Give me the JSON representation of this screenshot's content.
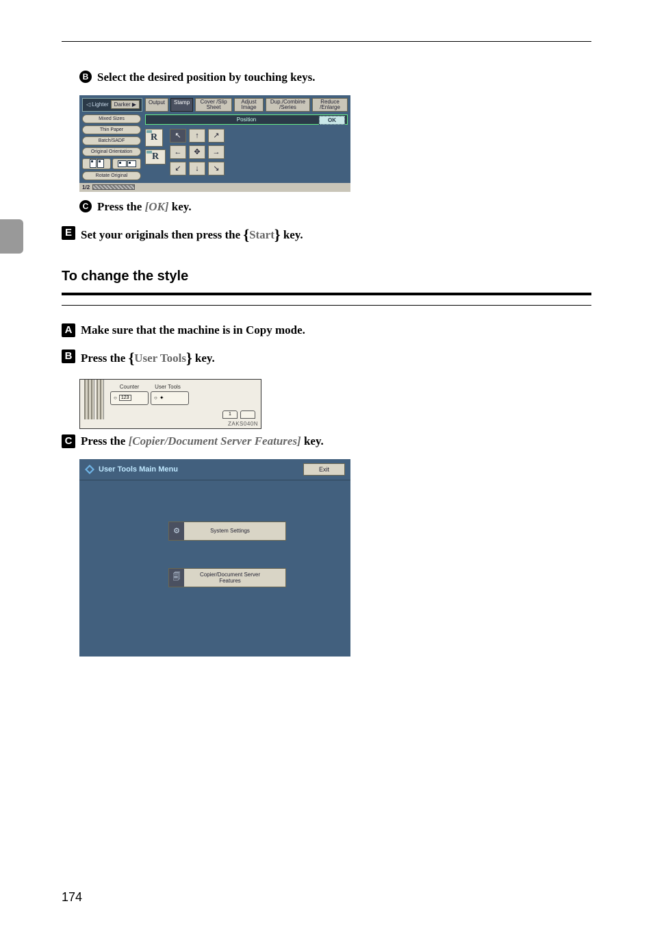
{
  "page_number": "174",
  "steps_upper": {
    "sub_b": "Select the desired position by touching keys.",
    "sub_c_prefix": "Press the ",
    "sub_c_key": "[OK]",
    "sub_c_suffix": " key.",
    "step5_prefix": "Set your originals then press the ",
    "step5_key": "Start",
    "step5_suffix": " key."
  },
  "section_title": "To change the style",
  "steps_lower": {
    "step1": "Make sure that the machine is in Copy mode.",
    "step2_prefix": "Press the ",
    "step2_key": "User Tools",
    "step2_suffix": " key.",
    "step3_prefix": "Press the ",
    "step3_key": "[Copier/Document Server Features]",
    "step3_suffix": " key."
  },
  "scr1": {
    "lighter": "Lighter",
    "darker": "Darker",
    "output": "Output",
    "stamp": "Stamp",
    "cover": "Cover /Slip Sheet",
    "adjust": "Adjust Image",
    "dup": "Dup./Combine /Series",
    "reduce": "Reduce /Enlarge",
    "mixed": "Mixed Sizes",
    "thin": "Thin Paper",
    "batch": "Batch/SADF",
    "orient": "Original Orientation",
    "rotate": "Rotate Original",
    "position": "Position",
    "ok": "OK",
    "R": "R",
    "page": "1",
    "total": "2"
  },
  "scr2": {
    "counter": "Counter",
    "usertools": "User Tools",
    "caption": "ZAKS040N",
    "num1": "1"
  },
  "scr3": {
    "title": "User Tools Main Menu",
    "exit": "Exit",
    "system": "System Settings",
    "copier": "Copier/Document Server Features"
  }
}
